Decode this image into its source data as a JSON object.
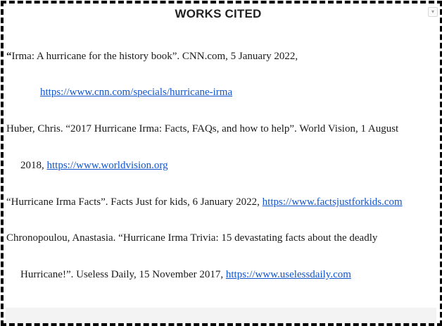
{
  "title": "WORKS CITED",
  "entries": [
    {
      "line1": "Irma: A hurricane for the history book”. CNN.com, 5 January 2022,",
      "opening_quote": "“",
      "link": "https://www.cnn.com/specials/hurricane-irma"
    },
    {
      "line1": "Huber, Chris. “2017 Hurricane Irma: Facts, FAQs, and how to help”. World Vision, 1 August",
      "line2_prefix": "2018, ",
      "link": "https://www.worldvision.org"
    },
    {
      "line1": "“Hurricane Irma Facts”. Facts Just for kids, 6 January 2022, ",
      "link": "https://www.factsjustforkids.com"
    },
    {
      "line1": "Chronopoulou, Anastasia. “Hurricane Irma Trivia: 15 devastating facts about the deadly",
      "line2_prefix": "Hurricane!”. Useless Daily, 15 November 2017, ",
      "link": "https://www.uselessdaily.com"
    }
  ],
  "icons": {
    "corner": "chevron-down-icon"
  }
}
